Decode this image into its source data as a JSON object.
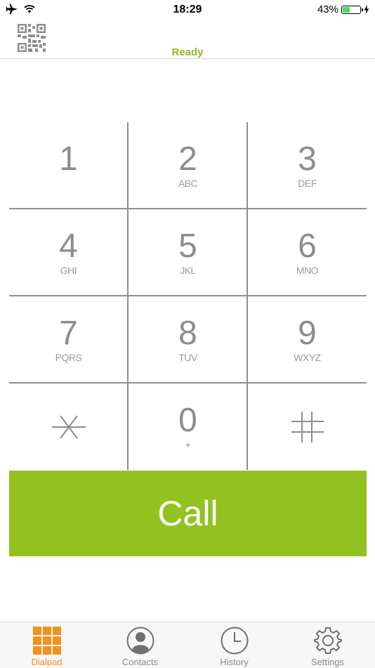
{
  "status_bar": {
    "time": "18:29",
    "battery_percent": "43%",
    "battery_level": 0.43
  },
  "header": {
    "status": "Ready"
  },
  "dialpad": {
    "keys": [
      {
        "digit": "1",
        "letters": ""
      },
      {
        "digit": "2",
        "letters": "ABC"
      },
      {
        "digit": "3",
        "letters": "DEF"
      },
      {
        "digit": "4",
        "letters": "GHI"
      },
      {
        "digit": "5",
        "letters": "JKL"
      },
      {
        "digit": "6",
        "letters": "MNO"
      },
      {
        "digit": "7",
        "letters": "PQRS"
      },
      {
        "digit": "8",
        "letters": "TUV"
      },
      {
        "digit": "9",
        "letters": "WXYZ"
      },
      {
        "digit": "*",
        "letters": ""
      },
      {
        "digit": "0",
        "letters": "+"
      },
      {
        "digit": "#",
        "letters": ""
      }
    ]
  },
  "call_button": {
    "label": "Call",
    "color": "#93c11f"
  },
  "tabbar": {
    "tabs": [
      {
        "label": "Dialpad",
        "icon": "dialpad-grid-icon",
        "active": true
      },
      {
        "label": "Contacts",
        "icon": "contact-person-icon",
        "active": false
      },
      {
        "label": "History",
        "icon": "clock-icon",
        "active": false
      },
      {
        "label": "Settings",
        "icon": "gear-icon",
        "active": false
      }
    ],
    "active_color": "#f0921e"
  },
  "colors": {
    "accent_green": "#8bbd1f",
    "tab_active": "#f0921e"
  }
}
